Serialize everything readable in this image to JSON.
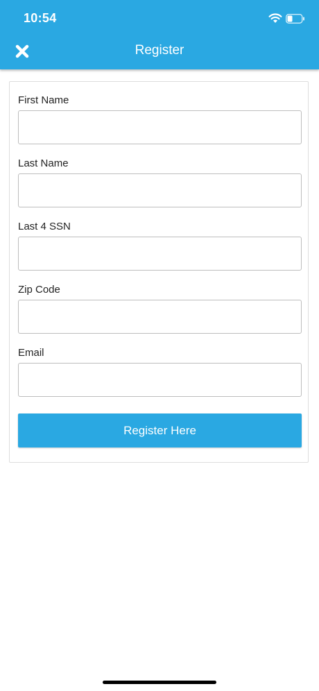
{
  "status_bar": {
    "time": "10:54"
  },
  "header": {
    "title": "Register",
    "close_icon": "close-x-icon",
    "background_color": "#2aa8e2"
  },
  "form": {
    "fields": [
      {
        "label": "First Name",
        "value": "",
        "placeholder": ""
      },
      {
        "label": "Last Name",
        "value": "",
        "placeholder": ""
      },
      {
        "label": "Last 4 SSN",
        "value": "",
        "placeholder": ""
      },
      {
        "label": "Zip Code",
        "value": "",
        "placeholder": ""
      },
      {
        "label": "Email",
        "value": "",
        "placeholder": ""
      }
    ],
    "submit_label": "Register Here",
    "submit_color": "#2aa8e2"
  }
}
